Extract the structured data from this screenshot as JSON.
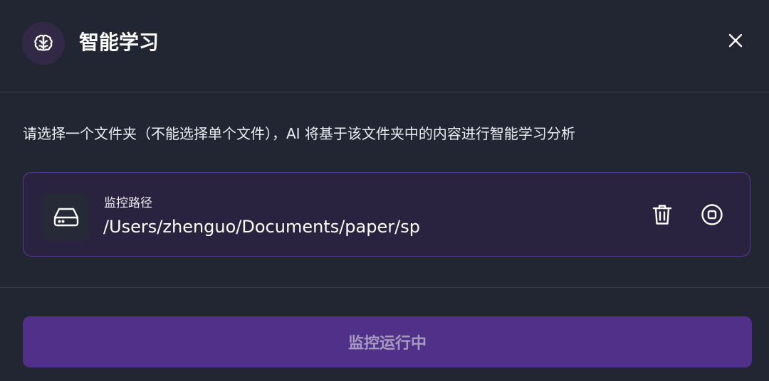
{
  "header": {
    "title": "智能学习",
    "icon": "brain-icon",
    "close_icon": "close-icon"
  },
  "description": "请选择一个文件夹（不能选择单个文件），AI 将基于该文件夹中的内容进行智能学习分析",
  "path_card": {
    "label": "监控路径",
    "path": "/Users/zhenguo/Documents/paper/sp",
    "drive_icon": "hard-drive-icon",
    "delete_icon": "trash-icon",
    "stop_icon": "stop-circle-icon"
  },
  "action": {
    "button_label": "监控运行中"
  },
  "colors": {
    "background": "#222633",
    "accent": "#51308a",
    "card_border": "#5a3a96",
    "card_background": "#2a2340"
  }
}
